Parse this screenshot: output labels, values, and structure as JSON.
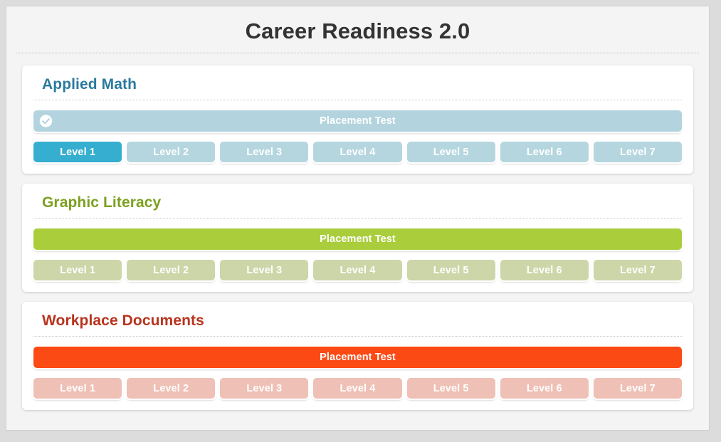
{
  "header": {
    "title": "Career Readiness 2.0"
  },
  "subjects": [
    {
      "name": "applied-math",
      "title": "Applied Math",
      "title_color": "#2b7a9e",
      "placement": {
        "label": "Placement Test",
        "color": "#b3d4de",
        "completed": true,
        "check_icon": "check-circle-icon"
      },
      "levels": [
        {
          "label": "Level 1",
          "color": "#35aed0",
          "active": true
        },
        {
          "label": "Level 2",
          "color": "#b5d6df",
          "active": false
        },
        {
          "label": "Level 3",
          "color": "#b5d6df",
          "active": false
        },
        {
          "label": "Level 4",
          "color": "#b5d6df",
          "active": false
        },
        {
          "label": "Level 5",
          "color": "#b5d6df",
          "active": false
        },
        {
          "label": "Level 6",
          "color": "#b5d6df",
          "active": false
        },
        {
          "label": "Level 7",
          "color": "#b5d6df",
          "active": false
        }
      ]
    },
    {
      "name": "graphic-literacy",
      "title": "Graphic Literacy",
      "title_color": "#7ca020",
      "placement": {
        "label": "Placement Test",
        "color": "#aacd3c",
        "completed": false,
        "check_icon": ""
      },
      "levels": [
        {
          "label": "Level 1",
          "color": "#ccd6a8",
          "active": false
        },
        {
          "label": "Level 2",
          "color": "#ccd6a8",
          "active": false
        },
        {
          "label": "Level 3",
          "color": "#ccd6a8",
          "active": false
        },
        {
          "label": "Level 4",
          "color": "#ccd6a8",
          "active": false
        },
        {
          "label": "Level 5",
          "color": "#ccd6a8",
          "active": false
        },
        {
          "label": "Level 6",
          "color": "#ccd6a8",
          "active": false
        },
        {
          "label": "Level 7",
          "color": "#ccd6a8",
          "active": false
        }
      ]
    },
    {
      "name": "workplace-documents",
      "title": "Workplace Documents",
      "title_color": "#b8331d",
      "placement": {
        "label": "Placement Test",
        "color": "#fb4a14",
        "completed": false,
        "check_icon": ""
      },
      "levels": [
        {
          "label": "Level 1",
          "color": "#efc0b5",
          "active": false
        },
        {
          "label": "Level 2",
          "color": "#efc0b5",
          "active": false
        },
        {
          "label": "Level 3",
          "color": "#efc0b5",
          "active": false
        },
        {
          "label": "Level 4",
          "color": "#efc0b5",
          "active": false
        },
        {
          "label": "Level 5",
          "color": "#efc0b5",
          "active": false
        },
        {
          "label": "Level 6",
          "color": "#efc0b5",
          "active": false
        },
        {
          "label": "Level 7",
          "color": "#efc0b5",
          "active": false
        }
      ]
    }
  ]
}
